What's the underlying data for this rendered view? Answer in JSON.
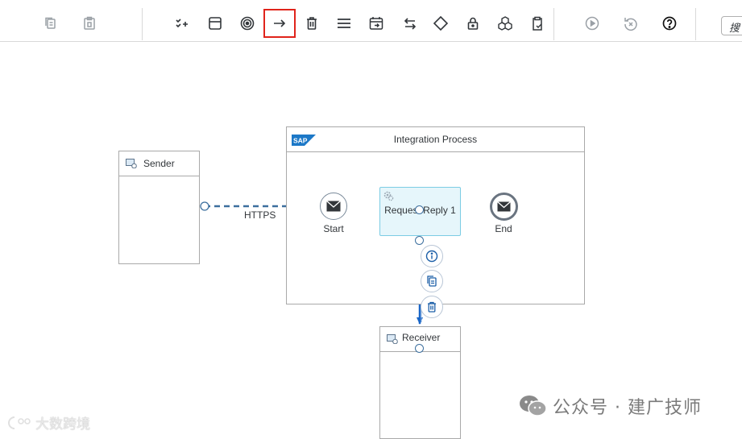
{
  "toolbar": {
    "items": [
      {
        "name": "copy-icon"
      },
      {
        "name": "paste-icon"
      },
      {
        "name": "checklist-add-icon"
      },
      {
        "name": "container-icon"
      },
      {
        "name": "target-icon"
      },
      {
        "name": "connect-arrow-icon",
        "highlighted": true
      },
      {
        "name": "delete-icon"
      },
      {
        "name": "menu-lines-icon"
      },
      {
        "name": "calendar-timer-icon"
      },
      {
        "name": "swap-arrows-icon"
      },
      {
        "name": "gateway-diamond-icon"
      },
      {
        "name": "lock-icon"
      },
      {
        "name": "cubes-icon"
      },
      {
        "name": "clipboard-check-icon"
      },
      {
        "name": "run-icon"
      },
      {
        "name": "undo-delete-icon"
      },
      {
        "name": "help-icon"
      }
    ],
    "search_placeholder": "搜"
  },
  "canvas": {
    "sender": {
      "label": "Sender"
    },
    "receiver": {
      "label": "Receiver"
    },
    "process": {
      "title": "Integration Process",
      "logo_text": "SAP"
    },
    "start_event": {
      "label": "Start"
    },
    "end_event": {
      "label": "End"
    },
    "task": {
      "label": "Request Reply 1"
    },
    "connection_label": "HTTPS",
    "context_menu": [
      "info-icon",
      "copy-icon",
      "delete-icon"
    ]
  },
  "watermarks": {
    "wechat": "公众号 · 建广技师",
    "left": "大数跨境"
  },
  "colors": {
    "highlight": "#e0241b",
    "flow_line": "#3c6f9e",
    "selected_connection": "#1a66c7",
    "task_fill": "#e6f6fb",
    "task_border": "#7ccce4"
  }
}
